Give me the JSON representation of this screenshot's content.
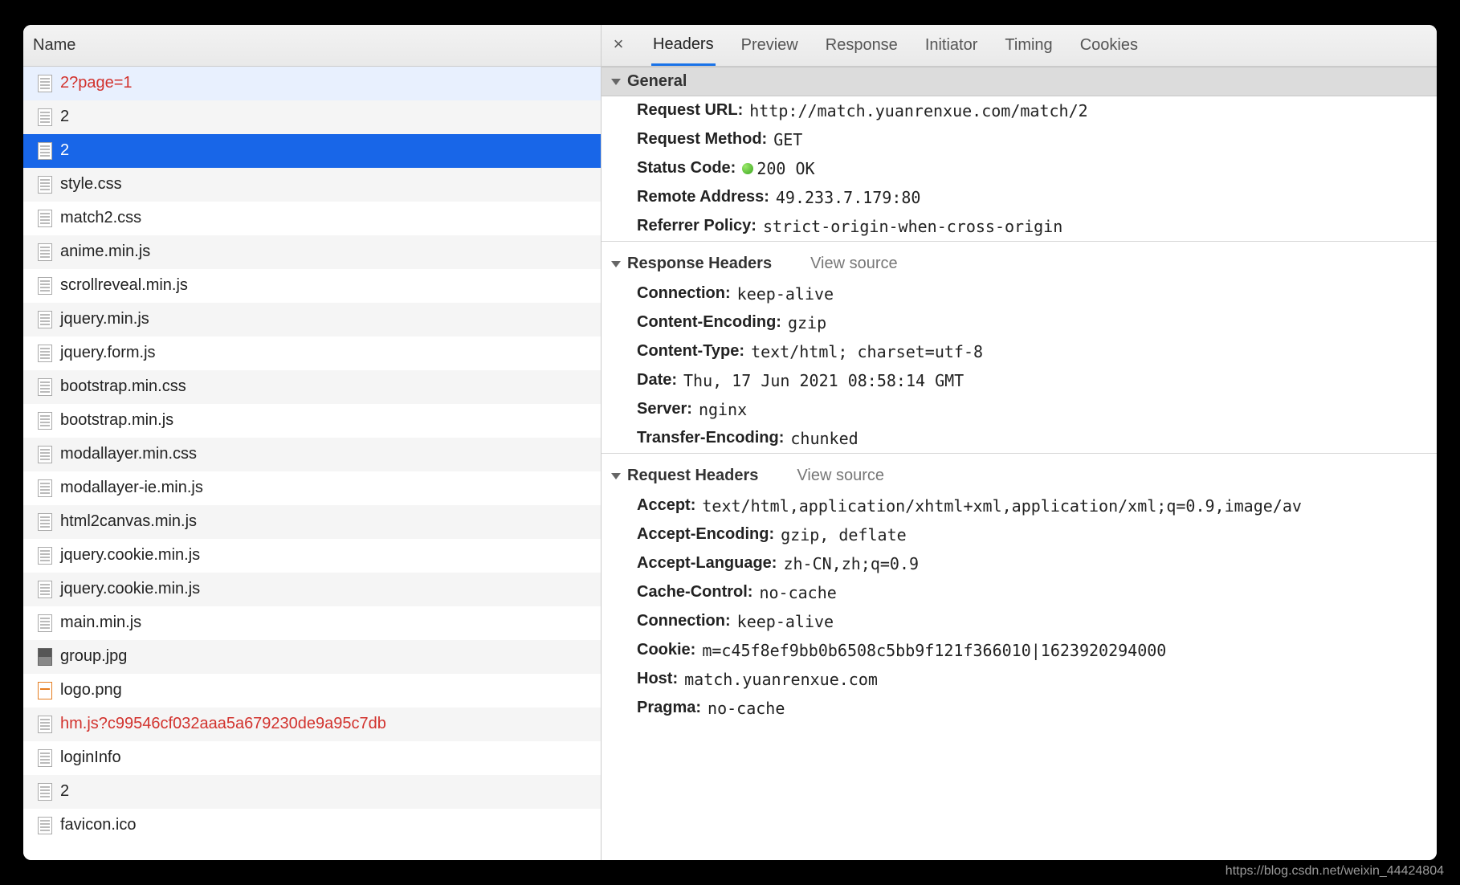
{
  "watermark": "https://blog.csdn.net/weixin_44424804",
  "left": {
    "header": "Name",
    "items": [
      {
        "label": "2?page=1",
        "icon": "doc",
        "cls": "red selected-light"
      },
      {
        "label": "2",
        "icon": "doc",
        "cls": ""
      },
      {
        "label": "2",
        "icon": "doc",
        "cls": "selected-dark"
      },
      {
        "label": "style.css",
        "icon": "doc",
        "cls": ""
      },
      {
        "label": "match2.css",
        "icon": "doc",
        "cls": ""
      },
      {
        "label": "anime.min.js",
        "icon": "doc",
        "cls": ""
      },
      {
        "label": "scrollreveal.min.js",
        "icon": "doc",
        "cls": ""
      },
      {
        "label": "jquery.min.js",
        "icon": "doc",
        "cls": ""
      },
      {
        "label": "jquery.form.js",
        "icon": "doc",
        "cls": ""
      },
      {
        "label": "bootstrap.min.css",
        "icon": "doc",
        "cls": ""
      },
      {
        "label": "bootstrap.min.js",
        "icon": "doc",
        "cls": ""
      },
      {
        "label": "modallayer.min.css",
        "icon": "doc",
        "cls": ""
      },
      {
        "label": "modallayer-ie.min.js",
        "icon": "doc",
        "cls": ""
      },
      {
        "label": "html2canvas.min.js",
        "icon": "doc",
        "cls": ""
      },
      {
        "label": "jquery.cookie.min.js",
        "icon": "doc",
        "cls": ""
      },
      {
        "label": "jquery.cookie.min.js",
        "icon": "doc",
        "cls": ""
      },
      {
        "label": "main.min.js",
        "icon": "doc",
        "cls": ""
      },
      {
        "label": "group.jpg",
        "icon": "img",
        "cls": ""
      },
      {
        "label": "logo.png",
        "icon": "png",
        "cls": ""
      },
      {
        "label": "hm.js?c99546cf032aaa5a679230de9a95c7db",
        "icon": "doc",
        "cls": "red"
      },
      {
        "label": "loginInfo",
        "icon": "doc",
        "cls": ""
      },
      {
        "label": "2",
        "icon": "doc",
        "cls": ""
      },
      {
        "label": "favicon.ico",
        "icon": "doc",
        "cls": ""
      }
    ]
  },
  "tabs": [
    "Headers",
    "Preview",
    "Response",
    "Initiator",
    "Timing",
    "Cookies"
  ],
  "activeTab": 0,
  "sections": {
    "general": {
      "title": "General",
      "items": [
        {
          "k": "Request URL:",
          "v": "http://match.yuanrenxue.com/match/2"
        },
        {
          "k": "Request Method:",
          "v": "GET"
        },
        {
          "k": "Status Code:",
          "v": "200 OK",
          "status": true
        },
        {
          "k": "Remote Address:",
          "v": "49.233.7.179:80"
        },
        {
          "k": "Referrer Policy:",
          "v": "strict-origin-when-cross-origin"
        }
      ]
    },
    "response": {
      "title": "Response Headers",
      "viewSource": "View source",
      "items": [
        {
          "k": "Connection:",
          "v": "keep-alive"
        },
        {
          "k": "Content-Encoding:",
          "v": "gzip"
        },
        {
          "k": "Content-Type:",
          "v": "text/html; charset=utf-8"
        },
        {
          "k": "Date:",
          "v": "Thu, 17 Jun 2021 08:58:14 GMT"
        },
        {
          "k": "Server:",
          "v": "nginx"
        },
        {
          "k": "Transfer-Encoding:",
          "v": "chunked"
        }
      ]
    },
    "request": {
      "title": "Request Headers",
      "viewSource": "View source",
      "items": [
        {
          "k": "Accept:",
          "v": "text/html,application/xhtml+xml,application/xml;q=0.9,image/av"
        },
        {
          "k": "Accept-Encoding:",
          "v": "gzip, deflate"
        },
        {
          "k": "Accept-Language:",
          "v": "zh-CN,zh;q=0.9"
        },
        {
          "k": "Cache-Control:",
          "v": "no-cache"
        },
        {
          "k": "Connection:",
          "v": "keep-alive"
        },
        {
          "k": "Cookie:",
          "v": "m=c45f8ef9bb0b6508c5bb9f121f366010|1623920294000"
        },
        {
          "k": "Host:",
          "v": "match.yuanrenxue.com"
        },
        {
          "k": "Pragma:",
          "v": "no-cache"
        }
      ]
    }
  }
}
